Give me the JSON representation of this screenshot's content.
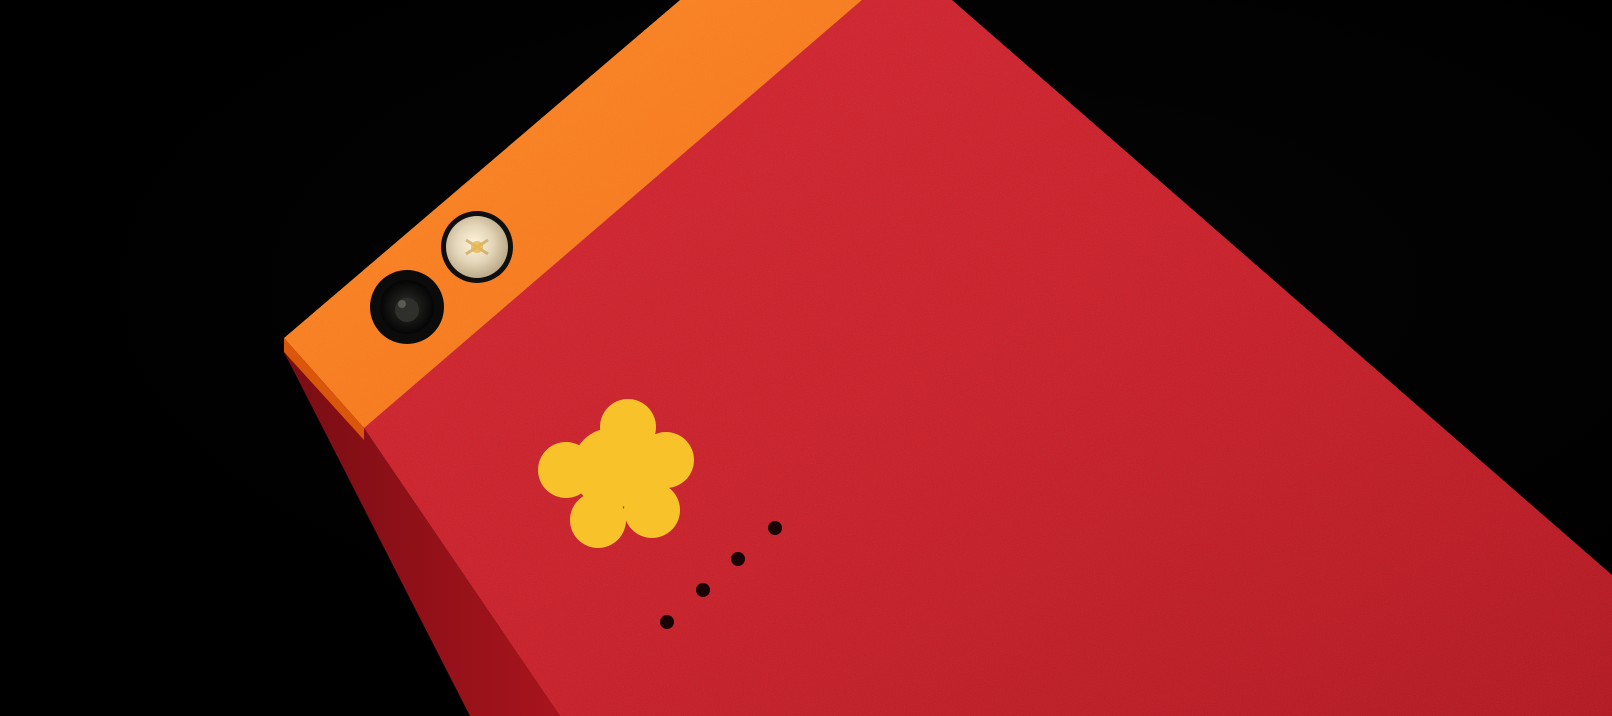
{
  "scene": {
    "subject": "phone-back",
    "colors": {
      "background": "#000000",
      "body": "#c81e28",
      "body_shadow": "#8f1219",
      "top_strip": "#ff7a1a",
      "top_strip_edge": "#e85f0a",
      "logo": "#f7c22a",
      "camera_ring": "#111111",
      "flash": "#d8cbb0",
      "mic_holes": "#1a0305"
    },
    "icons": [
      "camera-lens-icon",
      "flash-icon",
      "flower-logo-icon",
      "microphone-holes-icon"
    ]
  }
}
